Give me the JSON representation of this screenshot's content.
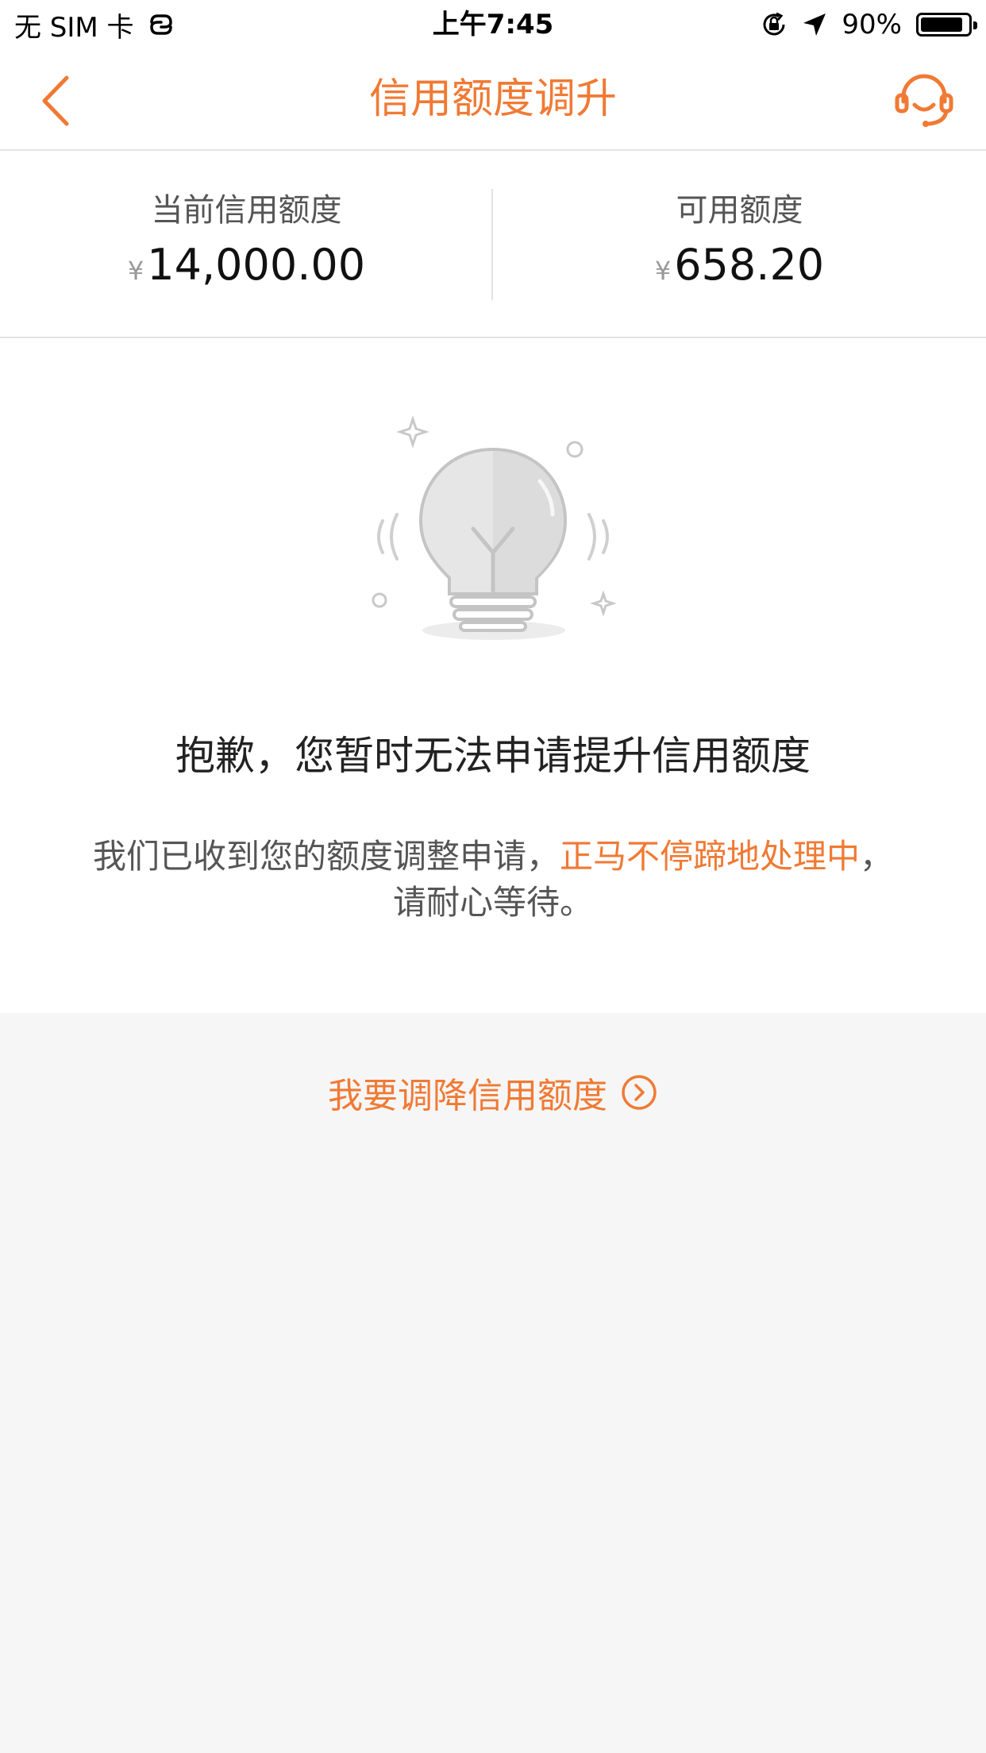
{
  "status_bar": {
    "carrier": "无 SIM 卡",
    "time": "上午7:45",
    "battery": "90%",
    "battery_level": 0.9
  },
  "nav": {
    "title": "信用额度调升",
    "back_icon": "chevron-left-icon",
    "service_icon": "customer-service-icon"
  },
  "summary": {
    "current_limit_label": "当前信用额度",
    "current_limit_currency": "¥",
    "current_limit_value": "14,000.00",
    "available_label": "可用额度",
    "available_currency": "¥",
    "available_value": "658.20"
  },
  "main": {
    "illustration_icon": "lightbulb-icon",
    "sorry_text": "抱歉，您暂时无法申请提升信用额度",
    "notice_part1": "我们已收到您的额度调整申请，",
    "notice_highlight": "正马不停蹄地处理中",
    "notice_part2": "，",
    "notice_line2": "请耐心等待。"
  },
  "bottom": {
    "decrease_label": "我要调降信用额度",
    "decrease_icon": "circle-arrow-right-icon"
  },
  "colors": {
    "accent": "#f07a34",
    "background": "#f6f6f6",
    "surface": "#ffffff"
  }
}
